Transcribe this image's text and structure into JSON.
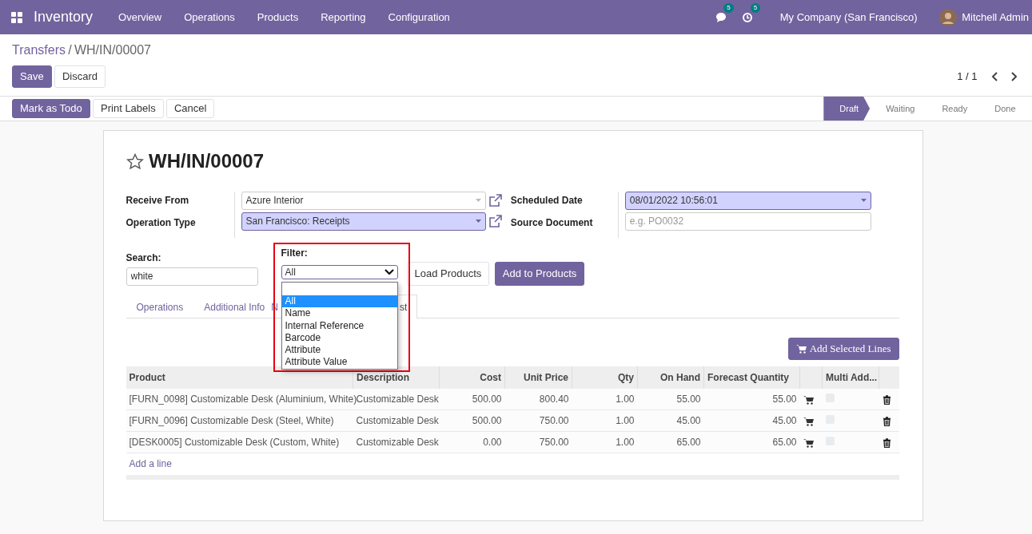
{
  "navbar": {
    "app_name": "Inventory",
    "menu": [
      "Overview",
      "Operations",
      "Products",
      "Reporting",
      "Configuration"
    ],
    "messages_badge": "5",
    "activities_badge": "5",
    "company": "My Company (San Francisco)",
    "user": "Mitchell Admin"
  },
  "breadcrumb": {
    "parent": "Transfers",
    "separator": "/",
    "current": "WH/IN/00007"
  },
  "form_buttons": [
    {
      "label": "Save",
      "kind": "primary"
    },
    {
      "label": "Discard",
      "kind": "secondary"
    }
  ],
  "pager": "1 / 1",
  "action_buttons": [
    {
      "label": "Mark as Todo",
      "kind": "primary"
    },
    {
      "label": "Print Labels",
      "kind": "secondary"
    },
    {
      "label": "Cancel",
      "kind": "secondary"
    }
  ],
  "statusbar": [
    {
      "label": "Draft",
      "selected": true
    },
    {
      "label": "Waiting",
      "selected": false
    },
    {
      "label": "Ready",
      "selected": false
    },
    {
      "label": "Done",
      "selected": false
    }
  ],
  "record": {
    "title": "WH/IN/00007",
    "starred": false
  },
  "fields_left": [
    {
      "label": "Receive From",
      "value": "Azure Interior",
      "required": false,
      "kind": "many2one"
    },
    {
      "label": "Operation Type",
      "value": "San Francisco: Receipts",
      "required": true,
      "kind": "many2one"
    }
  ],
  "fields_right": [
    {
      "label": "Scheduled Date",
      "value": "08/01/2022 10:56:01",
      "required": true,
      "kind": "date"
    },
    {
      "label": "Source Document",
      "placeholder": "e.g. PO0032",
      "required": false,
      "kind": "text"
    }
  ],
  "search": {
    "label": "Search:",
    "value": "white"
  },
  "filter": {
    "label": "Filter:",
    "value": "All",
    "expanded": true,
    "options": [
      {
        "label": "All",
        "selected": true
      },
      {
        "label": "Name",
        "selected": false
      },
      {
        "label": "Internal Reference",
        "selected": false
      },
      {
        "label": "Barcode",
        "selected": false
      },
      {
        "label": "Attribute",
        "selected": false
      },
      {
        "label": "Attribute Value",
        "selected": false
      }
    ]
  },
  "product_buttons": [
    {
      "label": "Load Products",
      "kind": "secondary"
    },
    {
      "label": "Add to Products",
      "kind": "primary"
    }
  ],
  "tabs": [
    {
      "label": "Operations",
      "selected": false
    },
    {
      "label": "Additional Info",
      "selected": false
    },
    {
      "label": "N",
      "selected": false
    },
    {
      "label": "st",
      "selected": true
    }
  ],
  "add_selected_lines": "Add Selected Lines",
  "table": {
    "columns": [
      "Product",
      "Description",
      "Cost",
      "Unit Price",
      "Qty",
      "On Hand",
      "Forecast Quantity",
      "Multi Add..."
    ],
    "rows": [
      {
        "product": "[FURN_0098] Customizable Desk (Aluminium, White)",
        "description": "Customizable Desk",
        "cost": "500.00",
        "unit_price": "800.40",
        "qty": "1.00",
        "on_hand": "55.00",
        "forecast": "55.00",
        "multi_add": false
      },
      {
        "product": "[FURN_0096] Customizable Desk (Steel, White)",
        "description": "Customizable Desk",
        "cost": "500.00",
        "unit_price": "750.00",
        "qty": "1.00",
        "on_hand": "45.00",
        "forecast": "45.00",
        "multi_add": false
      },
      {
        "product": "[DESK0005] Customizable Desk (Custom, White)",
        "description": "Customizable Desk",
        "cost": "0.00",
        "unit_price": "750.00",
        "qty": "1.00",
        "on_hand": "65.00",
        "forecast": "65.00",
        "multi_add": false
      }
    ],
    "add_line": "Add a line"
  }
}
